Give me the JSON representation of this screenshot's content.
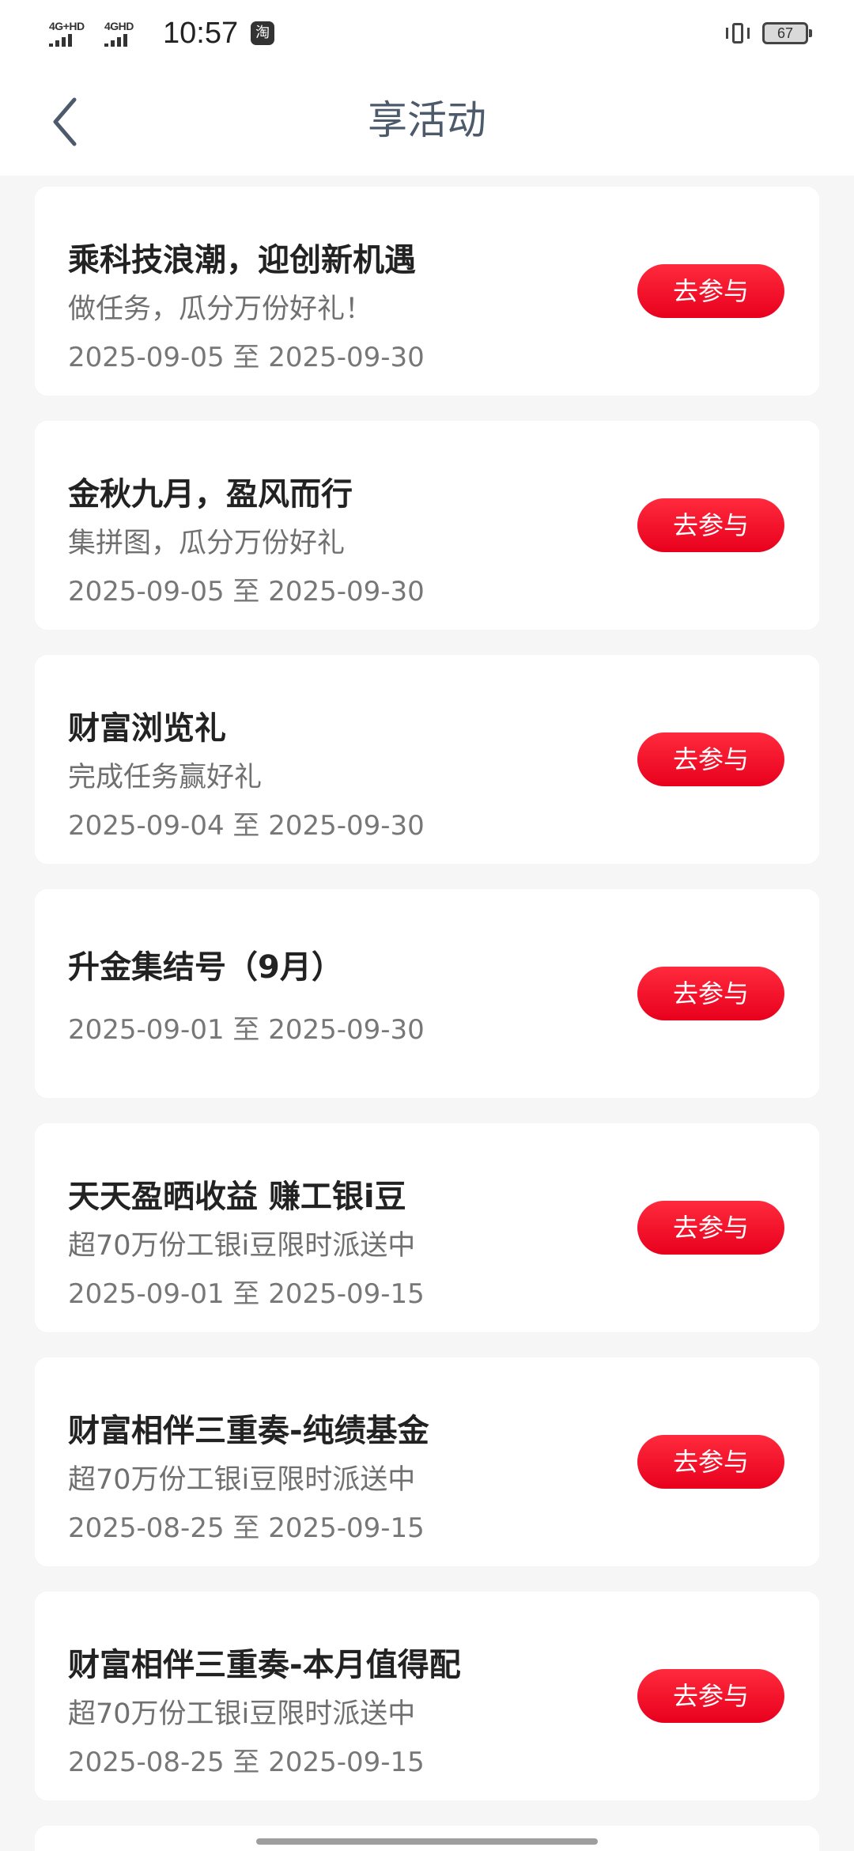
{
  "status_bar": {
    "network_1": "4G+HD",
    "network_2": "4GHD",
    "time": "10:57",
    "app_icon_glyph": "淘",
    "battery": "67"
  },
  "nav": {
    "title": "享活动"
  },
  "activities": [
    {
      "title": "乘科技浪潮，迎创新机遇",
      "subtitle": "做任务，瓜分万份好礼！",
      "date": "2025-09-05 至 2025-09-30",
      "button": "去参与"
    },
    {
      "title": "金秋九月，盈风而行",
      "subtitle": "集拼图，瓜分万份好礼",
      "date": "2025-09-05 至 2025-09-30",
      "button": "去参与"
    },
    {
      "title": "财富浏览礼",
      "subtitle": "完成任务赢好礼",
      "date": "2025-09-04 至 2025-09-30",
      "button": "去参与"
    },
    {
      "title": "升金集结号（9月）",
      "subtitle": "",
      "date": "2025-09-01 至 2025-09-30",
      "button": "去参与"
    },
    {
      "title": "天天盈晒收益 赚工银i豆",
      "subtitle": "超70万份工银i豆限时派送中",
      "date": "2025-09-01 至 2025-09-15",
      "button": "去参与"
    },
    {
      "title": "财富相伴三重奏-纯绩基金",
      "subtitle": "超70万份工银i豆限时派送中",
      "date": "2025-08-25 至 2025-09-15",
      "button": "去参与"
    },
    {
      "title": "财富相伴三重奏-本月值得配",
      "subtitle": "超70万份工银i豆限时派送中",
      "date": "2025-08-25 至 2025-09-15",
      "button": "去参与"
    }
  ],
  "colors": {
    "accent": "#e8001d",
    "title_text": "#4d5a6b",
    "background": "#f6f6f6"
  }
}
